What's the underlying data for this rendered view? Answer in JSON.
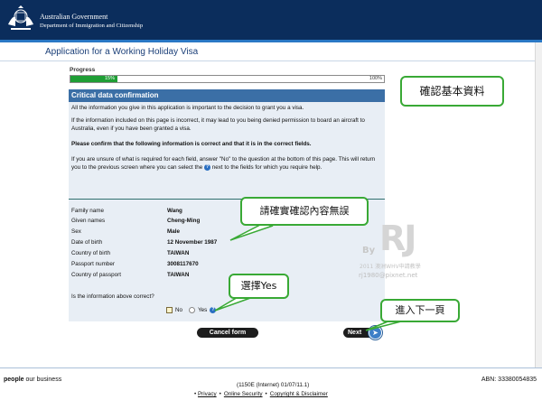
{
  "header": {
    "gov": "Australian Government",
    "dept": "Department of Immigration and Citizenship"
  },
  "app_title": "Application for a Working Holiday Visa",
  "progress": {
    "label": "Progress",
    "value_text": "15%",
    "end_text": "100%",
    "fraction": 0.15
  },
  "section": {
    "heading": "Critical data confirmation",
    "p1": "All the information you give in this application is important to the decision to grant you a visa.",
    "p2": "If the information included on this page is incorrect, it may lead to you being denied permission to board an aircraft to Australia, even if you have been granted a visa.",
    "p3": "Please confirm that the following information is correct and that it is in the correct fields.",
    "p4a": "If you are unsure of what is required for each field, answer \"No\" to the question at the bottom of this page. This will return you to the previous screen where you can select the",
    "p4b": "next to the fields for which you require help."
  },
  "fields": [
    {
      "label": "Family name",
      "value": "Wang"
    },
    {
      "label": "Given names",
      "value": "Cheng-Ming"
    },
    {
      "label": "Sex",
      "value": "Male"
    },
    {
      "label": "Date of birth",
      "value": "12 November 1987"
    },
    {
      "label": "Country of birth",
      "value": "TAIWAN"
    },
    {
      "label": "Passport number",
      "value": "3008117670"
    },
    {
      "label": "Country of passport",
      "value": "TAIWAN"
    }
  ],
  "question": {
    "text": "Is the information above correct?",
    "no": "No",
    "yes": "Yes"
  },
  "buttons": {
    "cancel": "Cancel form",
    "next": "Next"
  },
  "callouts": {
    "c1": "確認基本資料",
    "c2": "請確實確認內容無誤",
    "c3": "選擇Yes",
    "c4": "進入下一頁"
  },
  "watermark": {
    "by": "By",
    "rj": "RJ",
    "line": "2011 澳洲WHV申請教學",
    "mail": "rj1980@pixnet.net"
  },
  "footer": {
    "tag_bold": "people",
    "tag_rest": " our business",
    "abn": "ABN: 33380054835",
    "version": "(1150E (Internet) 01/07/11.1)",
    "links": [
      "Privacy",
      "Online Security",
      "Copyright & Disclaimer"
    ]
  },
  "colors": {
    "header_bg": "#0b2d5c",
    "panel_head": "#3b6fa6",
    "progress": "#1f9e35",
    "callout_border": "#39a935"
  }
}
